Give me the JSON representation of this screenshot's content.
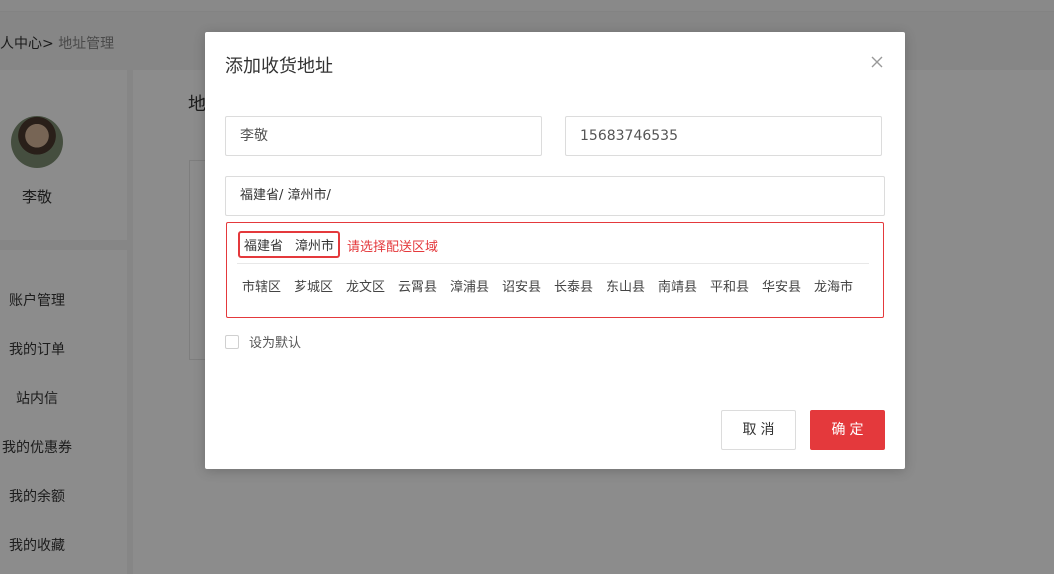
{
  "breadcrumb": {
    "parent": "人中心",
    "separator": ">",
    "current": "地址管理"
  },
  "user": {
    "name": "李敬"
  },
  "sidebar": {
    "items": [
      {
        "label": "账户管理"
      },
      {
        "label": "我的订单"
      },
      {
        "label": "站内信"
      },
      {
        "label": "我的优惠券"
      },
      {
        "label": "我的余额"
      },
      {
        "label": "我的收藏"
      }
    ]
  },
  "content": {
    "title_partial": "地"
  },
  "modal": {
    "title": "添加收货地址",
    "name_value": "李敬",
    "phone_value": "15683746535",
    "region_value": "福建省/ 漳州市/",
    "selected": {
      "province": "福建省",
      "city": "漳州市"
    },
    "hint": "请选择配送区域",
    "districts": [
      "市辖区",
      "芗城区",
      "龙文区",
      "云霄县",
      "漳浦县",
      "诏安县",
      "长泰县",
      "东山县",
      "南靖县",
      "平和县",
      "华安县",
      "龙海市"
    ],
    "default_label": "设为默认",
    "cancel_label": "取消",
    "confirm_label": "确定"
  },
  "colors": {
    "accent": "#e4393c",
    "border": "#dcdcdc",
    "overlay": "rgba(0,0,0,0.45)"
  },
  "icons": {
    "close": "close-icon"
  }
}
